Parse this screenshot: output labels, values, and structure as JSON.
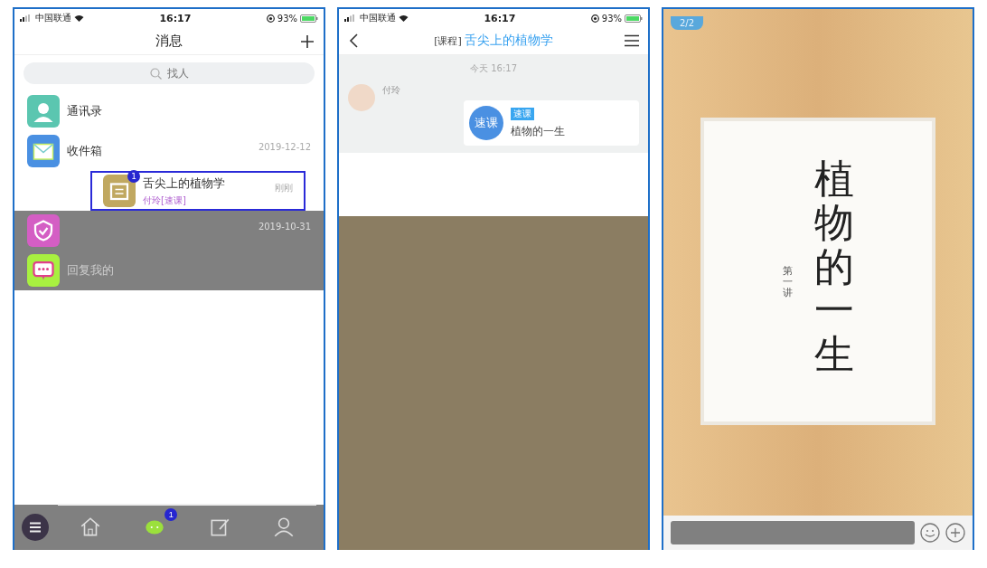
{
  "messages_screen": {
    "status": {
      "carrier": "中国联通",
      "time": "16:17",
      "battery": "93%"
    },
    "title": "消息",
    "search": {
      "placeholder": "找人"
    },
    "items": [
      {
        "kind": "contacts",
        "title": "通讯录",
        "selected": false
      },
      {
        "kind": "inbox",
        "title": "收件箱",
        "time": "2019-12-12",
        "selected": false
      },
      {
        "kind": "course",
        "title": "舌尖上的植物学",
        "badge": "1",
        "time": "刚刚",
        "preview": "付玲[速课]",
        "selected": true
      },
      {
        "kind": "notice",
        "time": "2019-10-31",
        "selected": false
      },
      {
        "kind": "reply",
        "title": "回复我的",
        "selected": false
      }
    ],
    "tabbar": [
      {
        "kind": "home",
        "selected": false
      },
      {
        "kind": "chat",
        "badge": "1",
        "selected": true
      },
      {
        "kind": "edit",
        "selected": false
      },
      {
        "kind": "person",
        "selected": false
      }
    ]
  },
  "chat_screen": {
    "status": {
      "carrier": "中国联通",
      "time": "16:17",
      "battery": "93%"
    },
    "title_prefix": "[课程]",
    "title": "舌尖上的植物学",
    "time_divider": "今天 16:17",
    "messages": [
      {
        "sender": "付玲",
        "card": {
          "logo": "速课",
          "tag": "速课",
          "title": "植物的一生"
        }
      }
    ]
  },
  "slide_screen": {
    "page_indicator": "2/2",
    "slide": {
      "title": "植物的一生",
      "subtitle": "第一讲"
    }
  }
}
